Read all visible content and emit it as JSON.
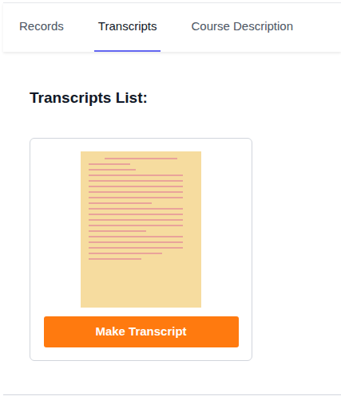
{
  "tabs": [
    {
      "label": "Records",
      "selected": false
    },
    {
      "label": "Transcripts",
      "selected": true
    },
    {
      "label": "Course Description",
      "selected": false
    }
  ],
  "heading": "Transcripts List:",
  "transcripts": [
    {
      "button": "Make Transcript"
    }
  ]
}
